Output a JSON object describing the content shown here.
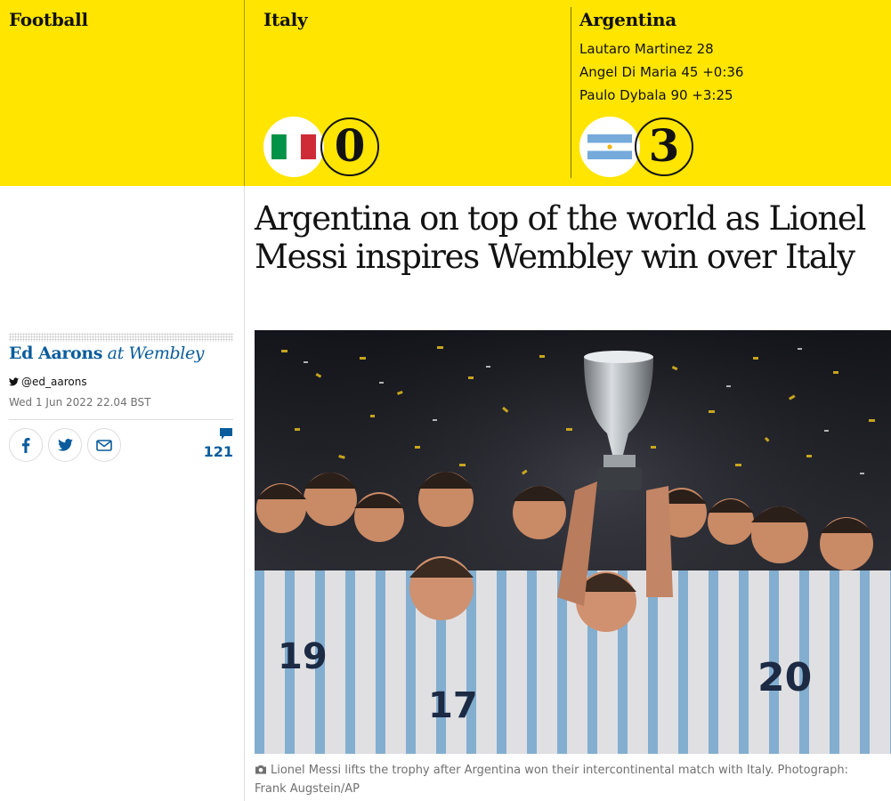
{
  "header": {
    "section": "Football",
    "home": {
      "name": "Italy",
      "score": "0",
      "scorers": []
    },
    "away": {
      "name": "Argentina",
      "score": "3",
      "scorers": [
        "Lautaro Martinez 28",
        "Angel Di Maria 45 +0:36",
        "Paulo Dybala 90 +3:25"
      ]
    }
  },
  "article": {
    "headline": "Argentina on top of the world as Lionel Messi inspires Wembley win over Italy",
    "byline": {
      "author": "Ed Aarons",
      "location": "at Wembley"
    },
    "twitter": "@ed_aarons",
    "date": "Wed 1 Jun 2022 22.04 BST",
    "comment_count": "121",
    "caption": "Lionel Messi lifts the trophy after Argentina won their intercontinental match with Italy. Photograph: Frank Augstein/AP"
  },
  "icons": {
    "facebook": "facebook-icon",
    "twitter": "twitter-icon",
    "email": "email-icon",
    "comments": "comment-icon",
    "camera": "camera-icon"
  },
  "colors": {
    "header_bg": "#ffe500",
    "link_blue": "#0a5c9c",
    "text": "#121212",
    "meta_grey": "#707070",
    "italy_green": "#009246",
    "italy_red": "#ce2b37",
    "argentina_blue": "#75aadb"
  }
}
